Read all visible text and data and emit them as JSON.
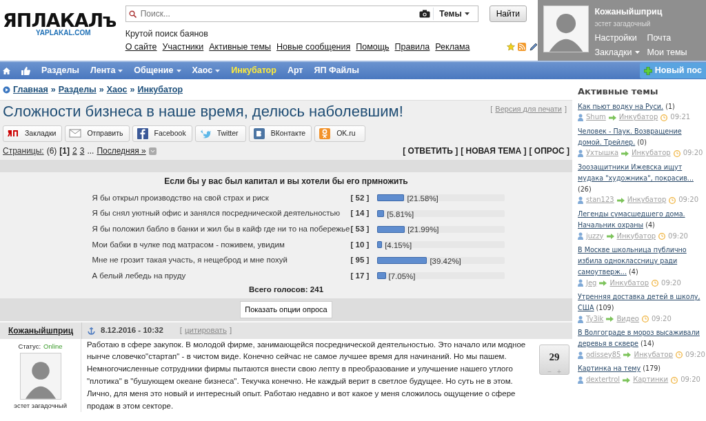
{
  "header": {
    "logo": {
      "title": "ЯПЛАКАЛъ",
      "subtitle": "YAPLAKAL.COM"
    },
    "search": {
      "placeholder": "Поиск...",
      "scope": "Темы",
      "button": "Найти"
    },
    "tagline": "Крутой поиск баянов",
    "links": [
      "О сайте",
      "Участники",
      "Активные темы",
      "Новые сообщения",
      "Помощь",
      "Правила",
      "Реклама"
    ],
    "user": {
      "name": "Кожаныйшприц",
      "title": "эстет загадочный",
      "links": [
        {
          "label": "Настройки",
          "dropdown": false
        },
        {
          "label": "Почта",
          "dropdown": false
        },
        {
          "label": "Закладки",
          "dropdown": true
        },
        {
          "label": "Мои темы",
          "dropdown": false
        }
      ]
    }
  },
  "nav": {
    "items": [
      {
        "label": "Разделы",
        "dropdown": false,
        "highlighted": false
      },
      {
        "label": "Лента",
        "dropdown": true,
        "highlighted": false
      },
      {
        "label": "Общение",
        "dropdown": true,
        "highlighted": false
      },
      {
        "label": "Хаос",
        "dropdown": true,
        "highlighted": false
      },
      {
        "label": "Инкубатор",
        "dropdown": false,
        "highlighted": true
      },
      {
        "label": "Арт",
        "dropdown": false,
        "highlighted": false
      },
      {
        "label": "ЯП Файлы",
        "dropdown": false,
        "highlighted": false
      }
    ],
    "new_post": "Новый пос"
  },
  "breadcrumb": [
    {
      "label": "Главная"
    },
    {
      "separator": "»",
      "label": "Разделы"
    },
    {
      "separator": "»",
      "label": "Хаос"
    },
    {
      "separator": "»",
      "label": "Инкубатор"
    }
  ],
  "topic": {
    "title": "Сложности бизнеса в наше время, делюсь наболевшим!",
    "print_link": {
      "open": "[",
      "label": "Версия для печати",
      "close": "]"
    },
    "share": [
      {
        "kind": "yap",
        "label": "Закладки"
      },
      {
        "kind": "mail",
        "label": "Отправить"
      },
      {
        "kind": "facebook",
        "label": "Facebook"
      },
      {
        "kind": "twitter",
        "label": "Twitter"
      },
      {
        "kind": "vk",
        "label": "ВКонтакте"
      },
      {
        "kind": "ok",
        "label": "OK.ru"
      }
    ],
    "pages": {
      "label": "Страницы:",
      "count": "(6)",
      "selected_open": "[",
      "selected_close": "]",
      "items": [
        {
          "label": "1",
          "selected": true
        },
        {
          "label": "2",
          "selected": false
        },
        {
          "label": "3",
          "selected": false
        }
      ],
      "ellipsis": "...",
      "last": "Последняя »"
    },
    "actions": [
      "[ ОТВЕТИТЬ ]",
      "[ НОВАЯ ТЕМА ]",
      "[ ОПРОС ]"
    ]
  },
  "poll": {
    "question": "Если бы у вас был капитал и вы хотели бы его прмножить",
    "options": [
      {
        "label": "Я бы открыл производство на свой страх и риск",
        "votes": "[ 52 ]",
        "level": 0.2158,
        "percent": "[21.58%]"
      },
      {
        "label": "Я бы снял уютный офис и занялся посреднической деятельностью",
        "votes": "[ 14 ]",
        "level": 0.0581,
        "percent": "[5.81%]"
      },
      {
        "label": "Я бы положил бабло в банки и жил бы в кайф где ни то на побережье",
        "votes": "[ 53 ]",
        "level": 0.2199,
        "percent": "[21.99%]"
      },
      {
        "label": "Мои бабки в чулке под матрасом - поживем, увидим",
        "votes": "[ 10 ]",
        "level": 0.0415,
        "percent": "[4.15%]"
      },
      {
        "label": "Мне не грозит такая участь, я нещеброд и мне похуй",
        "votes": "[ 95 ]",
        "level": 0.3942,
        "percent": "[39.42%]"
      },
      {
        "label": "А белый лебедь на пруду",
        "votes": "[ 17 ]",
        "level": 0.0705,
        "percent": "[7.05%]"
      }
    ],
    "total": "Всего голосов: 241",
    "button": "Показать опции опроса"
  },
  "post": {
    "author": "Кожаныйшприц",
    "status_label": "Статус:",
    "status": "Online",
    "user_title": "эстет загадочный",
    "date": "8.12.2016 - 10:32",
    "quote": {
      "open": "[",
      "label": "цитировать",
      "close": "]"
    },
    "text": "Работаю в сфере закупок. В молодой фирме, занимающейся посреднической деятельностью. Это начало или модное нынче словечко\"стартап\" - в чистом виде. Конечно сейчас не самое лучшее время для начинаний. Но мы пашем. Немногочисленные сотрудники фирмы пытаются внести свою лепту в преобразование и улучшение нашего утлого \"плотика\" в \"бушующем океане бизнеса\". Текучка конечно. Не каждый верит в светлое будущее. Но суть не в этом. Лично, для меня это новый и интересный опыт. Работаю недавно и вот какое у меня сложилось ощущение о сфере продаж в этом секторе.",
    "rating": "29",
    "minus": "−",
    "plus": "+"
  },
  "sidebar": {
    "title": "Активные темы",
    "topics": [
      {
        "title": "Как пьют водку на Руси.",
        "count": "(1)",
        "user": "Shum",
        "section": "Инкубатор",
        "time": "09:21"
      },
      {
        "title": "Человек - Паук. Возвращение домой. Трейлер.",
        "count": "(0)",
        "user": "Ухтышка",
        "section": "Инкубатор",
        "time": "09:20"
      },
      {
        "title": "Зоозащитники Ижевска ищут мудака \"художника\", покрасив...",
        "count": "(26)",
        "user": "stan123",
        "section": "Инкубатор",
        "time": "09:20"
      },
      {
        "title": "Легенды сумасшедшего дома. Начальник охраны",
        "count": "(4)",
        "user": "juzzy",
        "section": "Инкубатор",
        "time": "09:20"
      },
      {
        "title": "В Москве школьница публично избила одноклассницу ради самоутверж...",
        "count": "(4)",
        "user": "Jeg",
        "section": "Инкубатор",
        "time": "09:20"
      },
      {
        "title": "Утренняя доставка детей в школу, США",
        "count": "(109)",
        "user": "Ty3ik",
        "section": "Видео",
        "time": "09:20"
      },
      {
        "title": "В Волгограде в мороз высаживали деревья в сквере",
        "count": "(14)",
        "user": "odissey85",
        "section": "Инкубатор",
        "time": "09:20"
      },
      {
        "title": "Картинка на тему",
        "count": "(179)",
        "user": "dextertrol",
        "section": "Картинки",
        "time": "09:20"
      }
    ]
  }
}
